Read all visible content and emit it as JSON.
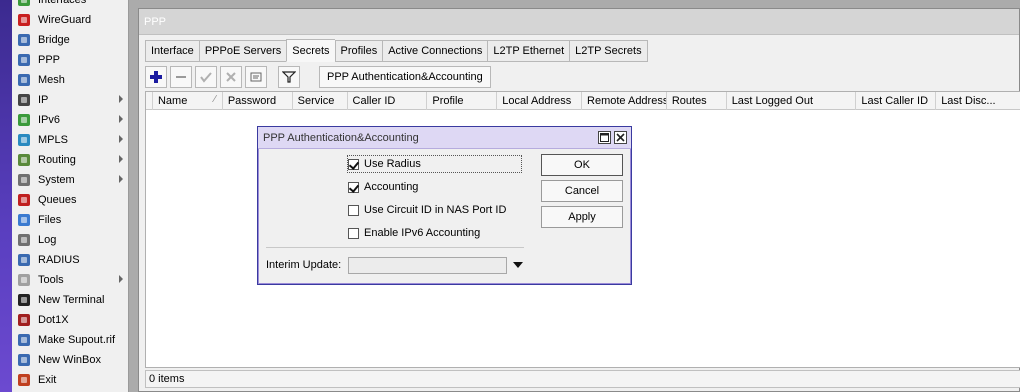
{
  "sidebar": {
    "items": [
      {
        "label": "Interfaces",
        "icon": "interfaces-icon",
        "color": "#3a9a3a",
        "arrow": false
      },
      {
        "label": "WireGuard",
        "icon": "wireguard-icon",
        "color": "#c82020",
        "arrow": false
      },
      {
        "label": "Bridge",
        "icon": "bridge-icon",
        "color": "#3a6ab0",
        "arrow": false
      },
      {
        "label": "PPP",
        "icon": "ppp-icon",
        "color": "#3a6ab0",
        "arrow": false
      },
      {
        "label": "Mesh",
        "icon": "mesh-icon",
        "color": "#3a6ab0",
        "arrow": false
      },
      {
        "label": "IP",
        "icon": "ip-icon",
        "color": "#444444",
        "arrow": true
      },
      {
        "label": "IPv6",
        "icon": "ipv6-icon",
        "color": "#3a9a3a",
        "arrow": true
      },
      {
        "label": "MPLS",
        "icon": "mpls-icon",
        "color": "#2a8ac0",
        "arrow": true
      },
      {
        "label": "Routing",
        "icon": "routing-icon",
        "color": "#5a8a3a",
        "arrow": true
      },
      {
        "label": "System",
        "icon": "system-icon",
        "color": "#707070",
        "arrow": true
      },
      {
        "label": "Queues",
        "icon": "queues-icon",
        "color": "#c02020",
        "arrow": false
      },
      {
        "label": "Files",
        "icon": "files-icon",
        "color": "#3a7ad0",
        "arrow": false
      },
      {
        "label": "Log",
        "icon": "log-icon",
        "color": "#707070",
        "arrow": false
      },
      {
        "label": "RADIUS",
        "icon": "radius-icon",
        "color": "#3a6ab0",
        "arrow": false
      },
      {
        "label": "Tools",
        "icon": "tools-icon",
        "color": "#a0a0a0",
        "arrow": true
      },
      {
        "label": "New Terminal",
        "icon": "terminal-icon",
        "color": "#222222",
        "arrow": false
      },
      {
        "label": "Dot1X",
        "icon": "dot1x-icon",
        "color": "#a02020",
        "arrow": false
      },
      {
        "label": "Make Supout.rif",
        "icon": "supout-icon",
        "color": "#3a6ab0",
        "arrow": false
      },
      {
        "label": "New WinBox",
        "icon": "winbox-icon",
        "color": "#3a6ab0",
        "arrow": false
      },
      {
        "label": "Exit",
        "icon": "exit-icon",
        "color": "#c04020",
        "arrow": false
      }
    ]
  },
  "window": {
    "title": "PPP",
    "tabs": [
      {
        "label": "Interface",
        "active": false
      },
      {
        "label": "PPPoE Servers",
        "active": false
      },
      {
        "label": "Secrets",
        "active": true
      },
      {
        "label": "Profiles",
        "active": false
      },
      {
        "label": "Active Connections",
        "active": false
      },
      {
        "label": "L2TP Ethernet",
        "active": false
      },
      {
        "label": "L2TP Secrets",
        "active": false
      }
    ],
    "toolbar": {
      "auth_button": "PPP Authentication&Accounting"
    },
    "columns": [
      "Name",
      "Password",
      "Service",
      "Caller ID",
      "Profile",
      "Local Address",
      "Remote Address",
      "Routes",
      "Last Logged Out",
      "Last Caller ID",
      "Last Disc..."
    ],
    "status": "0 items"
  },
  "dialog": {
    "title": "PPP Authentication&Accounting",
    "options": [
      {
        "label": "Use Radius",
        "checked": true
      },
      {
        "label": "Accounting",
        "checked": true
      },
      {
        "label": "Use Circuit ID in NAS Port ID",
        "checked": false
      },
      {
        "label": "Enable IPv6 Accounting",
        "checked": false
      }
    ],
    "interim_label": "Interim Update:",
    "interim_value": "",
    "buttons": {
      "ok": "OK",
      "cancel": "Cancel",
      "apply": "Apply"
    }
  },
  "colors": {
    "accent": "#1a1aa0",
    "dialog_title_bg": "#ded8f4"
  }
}
